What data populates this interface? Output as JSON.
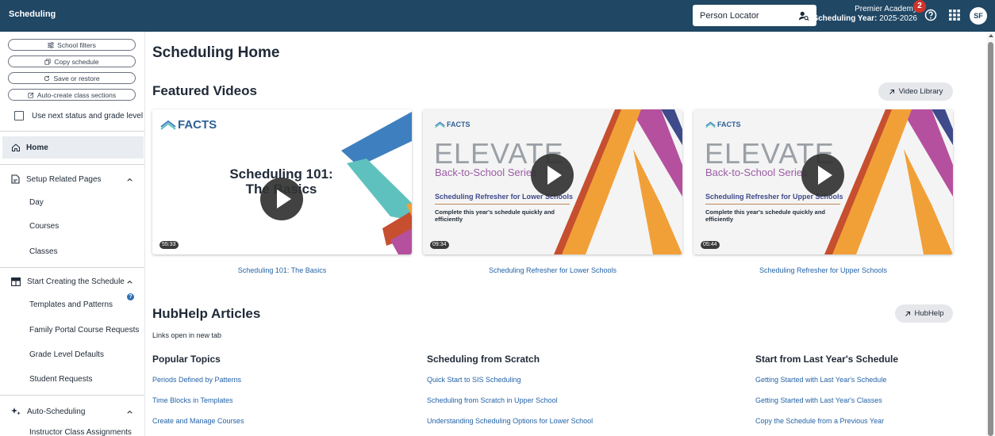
{
  "topbar": {
    "app_title": "Scheduling",
    "person_locator": "Person Locator",
    "school_name": "Premier Academy",
    "year_label": "Scheduling Year:",
    "year_value": "2025-2026",
    "notification_count": "2",
    "avatar_initials": "SF",
    "bar_color": "#204764"
  },
  "sidebar": {
    "buttons": [
      {
        "label": "School filters",
        "icon": "sliders-icon"
      },
      {
        "label": "Copy schedule",
        "icon": "copy-icon"
      },
      {
        "label": "Save or restore",
        "icon": "restore-icon"
      },
      {
        "label": "Auto-create class sections",
        "icon": "edit-square-icon"
      }
    ],
    "checkbox_label": "Use next status and grade level",
    "home": "Home",
    "sections": [
      {
        "label": "Setup Related Pages",
        "items": [
          "Day",
          "Courses",
          "Classes"
        ]
      },
      {
        "label": "Start Creating the Schedule",
        "items": [
          "Templates and Patterns",
          "Family Portal Course Requests",
          "Grade Level Defaults",
          "Student Requests"
        ],
        "info_badge": "?"
      },
      {
        "label": "Auto-Scheduling",
        "items": [
          "Instructor Class Assignments"
        ]
      }
    ]
  },
  "main": {
    "page_title": "Scheduling Home",
    "featured_title": "Featured Videos",
    "video_library_btn": "Video Library",
    "videos": [
      {
        "title": "Scheduling 101: The Basics",
        "duration": "55:33",
        "thumb_logo": "FACTS",
        "thumb_heading_1": "Scheduling 101:",
        "thumb_heading_2": "The Basics"
      },
      {
        "title": "Scheduling Refresher for Lower Schools",
        "duration": "09:34",
        "thumb_logo": "FACTS",
        "thumb_elevate": "ELEVATE",
        "thumb_series": "Back-to-School Series",
        "thumb_heading": "Scheduling Refresher for Lower Schools",
        "thumb_sub": "Complete this year's schedule quickly and efficiently"
      },
      {
        "title": "Scheduling Refresher for Upper Schools",
        "duration": "05:44",
        "thumb_logo": "FACTS",
        "thumb_elevate": "ELEVATE",
        "thumb_series": "Back-to-School Series",
        "thumb_heading": "Scheduling Refresher for Upper Schools",
        "thumb_sub": "Complete this year's schedule quickly and efficiently"
      }
    ],
    "hubhelp_title": "HubHelp Articles",
    "hubhelp_btn": "HubHelp",
    "hubhelp_sub": "Links open in new tab",
    "columns": [
      {
        "heading": "Popular Topics",
        "links": [
          "Periods Defined by Patterns",
          "Time Blocks in Templates",
          "Create and Manage Courses"
        ]
      },
      {
        "heading": "Scheduling from Scratch",
        "links": [
          "Quick Start to SIS Scheduling",
          "Scheduling from Scratch in Upper School",
          "Understanding Scheduling Options for Lower School"
        ]
      },
      {
        "heading": "Start from Last Year's Schedule",
        "links": [
          "Getting Started with Last Year's Schedule",
          "Getting Started with Last Year's Classes",
          "Copy the Schedule from a Previous Year"
        ]
      }
    ],
    "link_color": "#2563a6"
  }
}
